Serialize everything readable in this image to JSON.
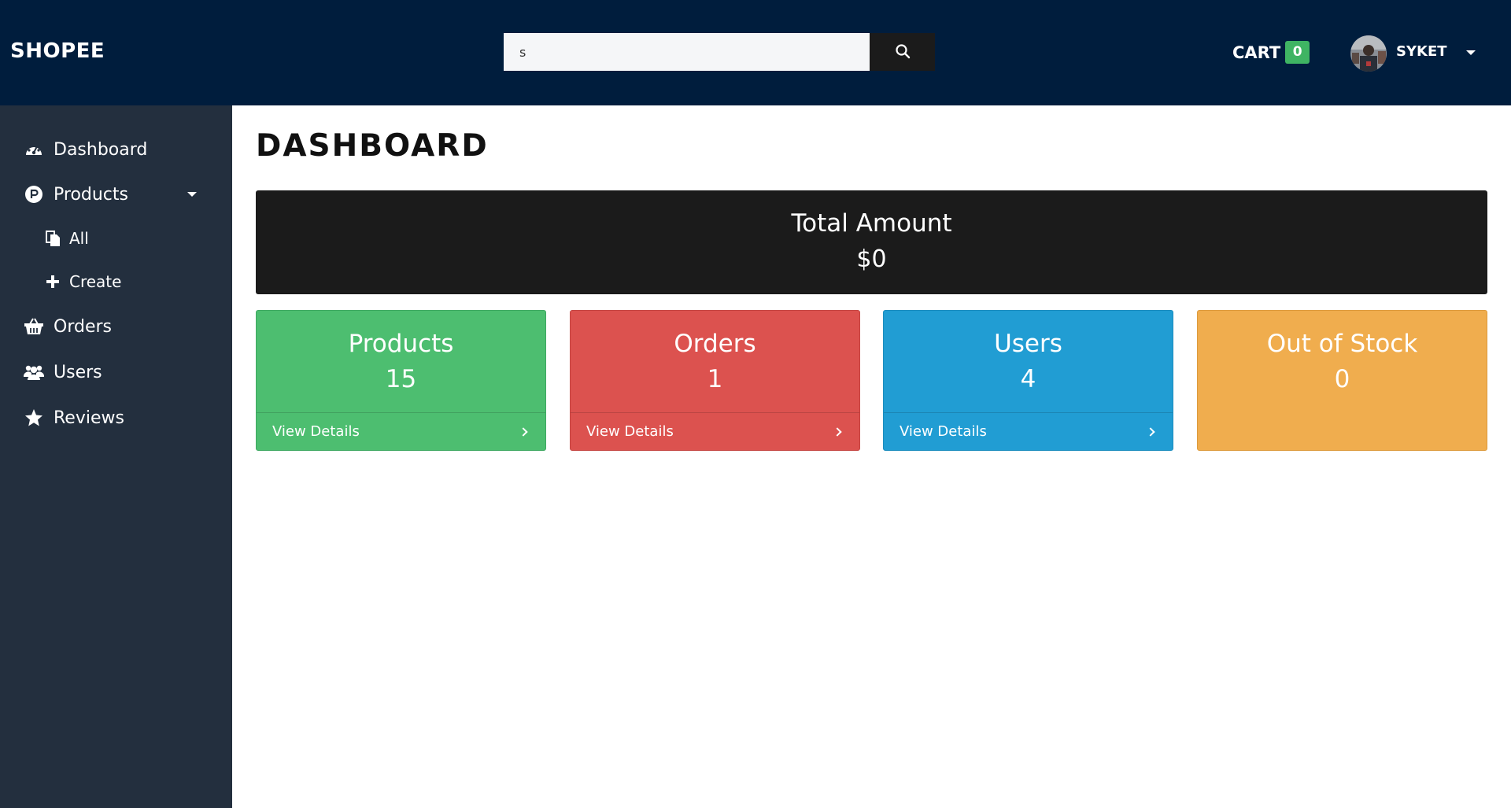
{
  "navbar": {
    "brand": "SHOPEE",
    "search": {
      "value": "s",
      "placeholder": ""
    },
    "cart_label": "CART",
    "cart_count": "0",
    "username": "SYKET"
  },
  "sidebar": {
    "items": [
      {
        "label": "Dashboard",
        "icon": "tachometer-icon"
      },
      {
        "label": "Products",
        "icon": "product-hunt-icon"
      },
      {
        "label": "All",
        "icon": "clipboard-icon"
      },
      {
        "label": "Create",
        "icon": "plus-icon"
      },
      {
        "label": "Orders",
        "icon": "shopping-basket-icon"
      },
      {
        "label": "Users",
        "icon": "users-icon"
      },
      {
        "label": "Reviews",
        "icon": "star-icon"
      }
    ]
  },
  "main": {
    "title": "DASHBOARD",
    "total": {
      "label": "Total Amount",
      "value": "$0"
    },
    "cards": [
      {
        "title": "Products",
        "value": "15",
        "link": "View Details",
        "color": "#4dbe70"
      },
      {
        "title": "Orders",
        "value": "1",
        "link": "View Details",
        "color": "#dc524f"
      },
      {
        "title": "Users",
        "value": "4",
        "link": "View Details",
        "color": "#219dd3"
      },
      {
        "title": "Out of Stock",
        "value": "0",
        "color": "#f0ad4e"
      }
    ]
  },
  "colors": {
    "navbar": "#001d3d",
    "sidebar": "#232f3e",
    "total_card": "#1b1b1b",
    "cart_badge": "#3fb463"
  }
}
